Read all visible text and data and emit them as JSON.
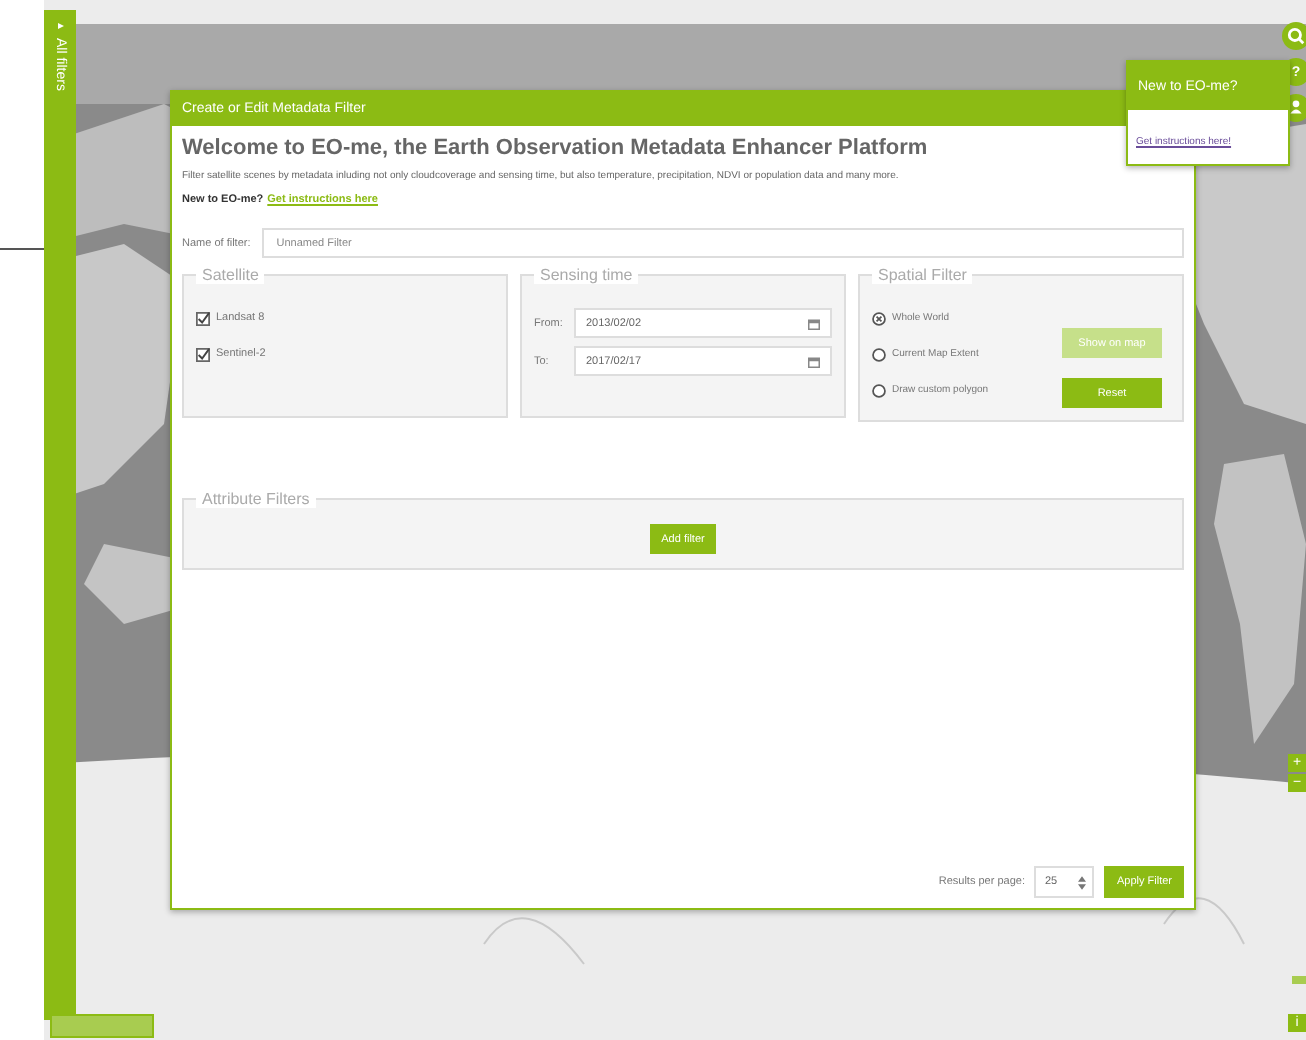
{
  "sidebar": {
    "label": "All filters"
  },
  "map_controls": {
    "help": "?",
    "zoom_in": "+",
    "zoom_out": "−",
    "info": "i"
  },
  "dialog": {
    "title": "Create or Edit Metadata Filter",
    "heading": "Welcome to EO-me, the Earth Observation Metadata Enhancer Platform",
    "description": "Filter satellite scenes by metadata inluding not only cloudcoverage and sensing time, but also temperature, precipitation, NDVI or population data and many more.",
    "intro": "New to EO-me?",
    "intro_link": "Get instructions here",
    "name_label": "Name of filter:",
    "name_placeholder": "Unnamed Filter",
    "satellite": {
      "legend": "Satellite",
      "options": [
        {
          "label": "Landsat 8",
          "checked": true
        },
        {
          "label": "Sentinel-2",
          "checked": true
        }
      ]
    },
    "sensing_time": {
      "legend": "Sensing time",
      "from_label": "From:",
      "from_value": "2013/02/02",
      "to_label": "To:",
      "to_value": "2017/02/17"
    },
    "spatial_filter": {
      "legend": "Spatial Filter",
      "options": [
        {
          "label": "Whole World",
          "selected": true
        },
        {
          "label": "Current Map Extent",
          "selected": false
        },
        {
          "label": "Draw custom polygon",
          "selected": false
        }
      ],
      "buttons": [
        {
          "label": "Show on map",
          "disabled": true
        },
        {
          "label": "Reset",
          "disabled": false
        }
      ]
    },
    "attribute_filters": {
      "legend": "Attribute Filters",
      "add_button": "Add filter"
    },
    "footer": {
      "results_label": "Results per page:",
      "results_value": "25",
      "apply_button": "Apply Filter"
    }
  },
  "popup": {
    "title": "New to EO-me?",
    "link": "Get instructions here!"
  }
}
